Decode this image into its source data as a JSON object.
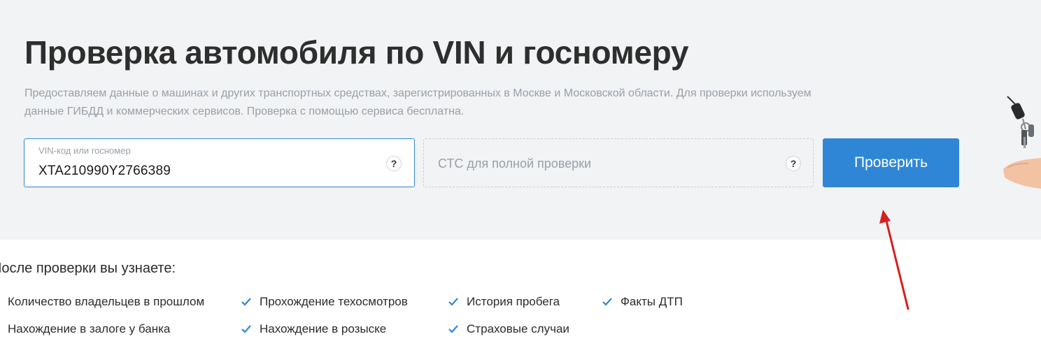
{
  "header": {
    "title": "Проверка автомобиля по VIN и госномеру",
    "subtitle": "Предоставляем данные о машинах и других транспортных средствах, зарегистрированных в Москве и Московской области. Для проверки используем данные ГИБДД и коммерческих сервисов. Проверка с помощью сервиса бесплатна."
  },
  "form": {
    "vin_label": "VIN-код или госномер",
    "vin_value": "XTA210990Y2766389",
    "vin_help": "?",
    "sts_placeholder": "СТС для полной проверки",
    "sts_help": "?",
    "submit_label": "Проверить"
  },
  "after_check": {
    "title": "После проверки вы узнаете:",
    "features": [
      "Количество владельцев в прошлом",
      "Прохождение техосмотров",
      "История пробега",
      "Факты ДТП",
      "Нахождение в залоге у банка",
      "Нахождение в розыске",
      "Страховые случаи"
    ]
  },
  "colors": {
    "accent": "#2f86d6",
    "hero_bg": "#f1f3f5",
    "annotation_arrow": "#d61f1f"
  },
  "icons": [
    "question-icon",
    "check-icon",
    "keys-in-hand-illustration",
    "red-arrow-annotation"
  ]
}
